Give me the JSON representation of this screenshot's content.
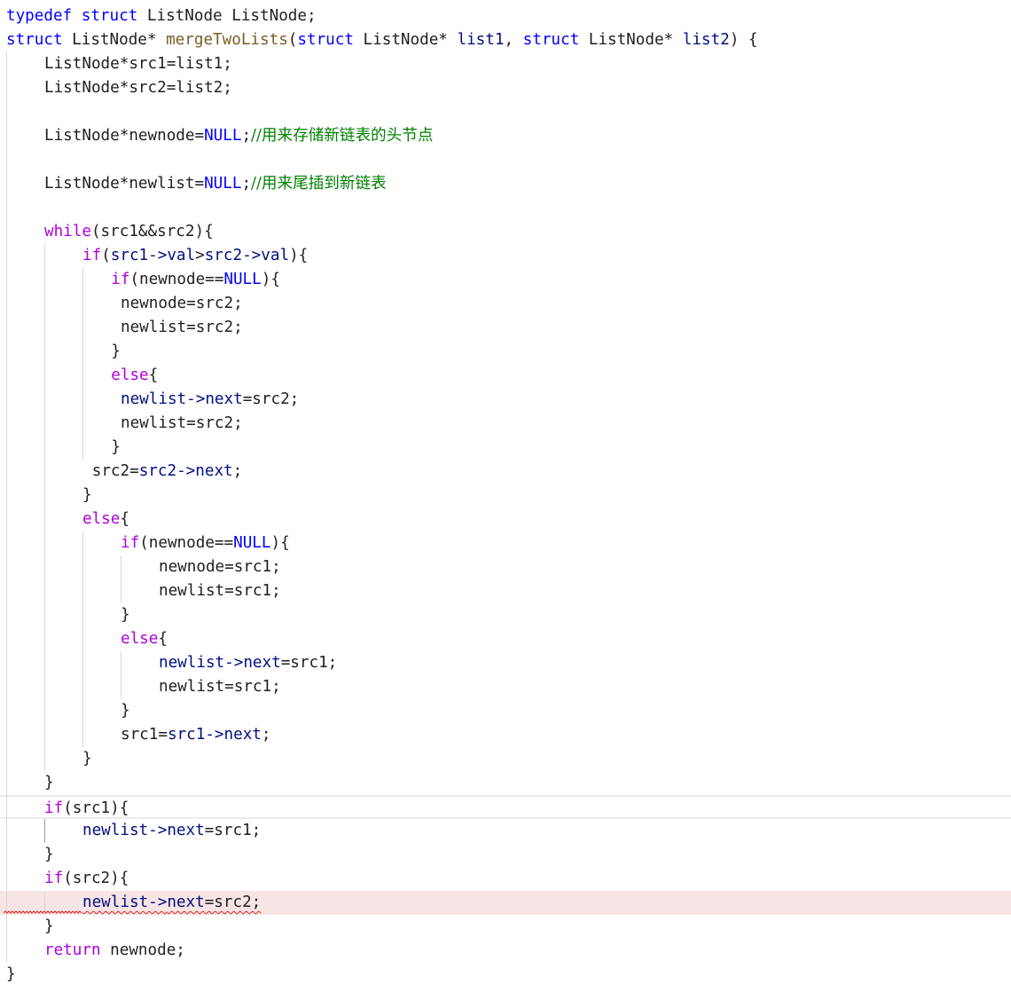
{
  "editor": {
    "language": "c",
    "colors": {
      "keyword": "#0000ff",
      "control": "#af00db",
      "function": "#795e26",
      "macro": "#0000ff",
      "member": "#001080",
      "comment": "#008000",
      "text": "#1f1f1f",
      "error_bg": "#f7e4e4",
      "error_squiggle": "#e02020",
      "indent_guide": "#d8d8d8"
    },
    "lines": [
      {
        "indent": 0,
        "tokens": [
          {
            "t": "typedef",
            "c": "kw"
          },
          {
            "t": " "
          },
          {
            "t": "struct",
            "c": "kw"
          },
          {
            "t": " ListNode ListNode;"
          }
        ]
      },
      {
        "indent": 0,
        "tokens": [
          {
            "t": "struct",
            "c": "kw"
          },
          {
            "t": " ListNode* "
          },
          {
            "t": "mergeTwoLists",
            "c": "fn"
          },
          {
            "t": "("
          },
          {
            "t": "struct",
            "c": "kw"
          },
          {
            "t": " ListNode* "
          },
          {
            "t": "list1",
            "c": "param"
          },
          {
            "t": ", "
          },
          {
            "t": "struct",
            "c": "kw"
          },
          {
            "t": " ListNode* "
          },
          {
            "t": "list2",
            "c": "param"
          },
          {
            "t": ") {"
          }
        ]
      },
      {
        "indent": 1,
        "tokens": [
          {
            "t": "ListNode*src1=list1;"
          }
        ]
      },
      {
        "indent": 1,
        "tokens": [
          {
            "t": "ListNode*src2=list2;"
          }
        ]
      },
      {
        "indent": 1,
        "tokens": []
      },
      {
        "indent": 1,
        "tokens": [
          {
            "t": "ListNode*newnode="
          },
          {
            "t": "NULL",
            "c": "macro"
          },
          {
            "t": ";"
          },
          {
            "t": "//用来存储新链表的头节点",
            "c": "cmt"
          }
        ]
      },
      {
        "indent": 1,
        "tokens": []
      },
      {
        "indent": 1,
        "tokens": [
          {
            "t": "ListNode*newlist="
          },
          {
            "t": "NULL",
            "c": "macro"
          },
          {
            "t": ";"
          },
          {
            "t": "//用来尾插到新链表",
            "c": "cmt"
          }
        ]
      },
      {
        "indent": 1,
        "tokens": []
      },
      {
        "indent": 1,
        "tokens": [
          {
            "t": "while",
            "c": "ctrl"
          },
          {
            "t": "(src1&&src2){"
          }
        ]
      },
      {
        "indent": 2,
        "tokens": [
          {
            "t": "if",
            "c": "ctrl"
          },
          {
            "t": "("
          },
          {
            "t": "src1->",
            "c": "mem"
          },
          {
            "t": "val",
            "c": "mem"
          },
          {
            "t": ">"
          },
          {
            "t": "src2->",
            "c": "mem"
          },
          {
            "t": "val",
            "c": "mem"
          },
          {
            "t": "){"
          }
        ]
      },
      {
        "indent": 2.75,
        "tokens": [
          {
            "t": "if",
            "c": "ctrl"
          },
          {
            "t": "(newnode=="
          },
          {
            "t": "NULL",
            "c": "macro"
          },
          {
            "t": "){"
          }
        ]
      },
      {
        "indent": 3,
        "tokens": [
          {
            "t": "newnode=src2;"
          }
        ]
      },
      {
        "indent": 3,
        "tokens": [
          {
            "t": "newlist=src2;"
          }
        ]
      },
      {
        "indent": 2.75,
        "tokens": [
          {
            "t": "}"
          }
        ]
      },
      {
        "indent": 2.75,
        "tokens": [
          {
            "t": "else",
            "c": "ctrl"
          },
          {
            "t": "{"
          }
        ]
      },
      {
        "indent": 3,
        "tokens": [
          {
            "t": "newlist->",
            "c": "mem"
          },
          {
            "t": "next",
            "c": "mem"
          },
          {
            "t": "=src2;"
          }
        ]
      },
      {
        "indent": 3,
        "tokens": [
          {
            "t": "newlist=src2;"
          }
        ]
      },
      {
        "indent": 2.75,
        "tokens": [
          {
            "t": "}"
          }
        ]
      },
      {
        "indent": 2.25,
        "tokens": [
          {
            "t": "src2="
          },
          {
            "t": "src2->",
            "c": "mem"
          },
          {
            "t": "next",
            "c": "mem"
          },
          {
            "t": ";"
          }
        ]
      },
      {
        "indent": 2,
        "tokens": [
          {
            "t": "}"
          }
        ]
      },
      {
        "indent": 2,
        "tokens": [
          {
            "t": "else",
            "c": "ctrl"
          },
          {
            "t": "{"
          }
        ]
      },
      {
        "indent": 3,
        "tokens": [
          {
            "t": "if",
            "c": "ctrl"
          },
          {
            "t": "(newnode=="
          },
          {
            "t": "NULL",
            "c": "macro"
          },
          {
            "t": "){"
          }
        ]
      },
      {
        "indent": 4,
        "tokens": [
          {
            "t": "newnode=src1;"
          }
        ]
      },
      {
        "indent": 4,
        "tokens": [
          {
            "t": "newlist=src1;"
          }
        ]
      },
      {
        "indent": 3,
        "tokens": [
          {
            "t": "}"
          }
        ]
      },
      {
        "indent": 3,
        "tokens": [
          {
            "t": "else",
            "c": "ctrl"
          },
          {
            "t": "{"
          }
        ]
      },
      {
        "indent": 4,
        "tokens": [
          {
            "t": "newlist->",
            "c": "mem"
          },
          {
            "t": "next",
            "c": "mem"
          },
          {
            "t": "=src1;"
          }
        ]
      },
      {
        "indent": 4,
        "tokens": [
          {
            "t": "newlist=src1;"
          }
        ]
      },
      {
        "indent": 3,
        "tokens": [
          {
            "t": "}"
          }
        ]
      },
      {
        "indent": 3,
        "tokens": [
          {
            "t": "src1="
          },
          {
            "t": "src1->",
            "c": "mem"
          },
          {
            "t": "next",
            "c": "mem"
          },
          {
            "t": ";"
          }
        ]
      },
      {
        "indent": 2,
        "tokens": [
          {
            "t": "}"
          }
        ]
      },
      {
        "indent": 1,
        "tokens": [
          {
            "t": "}"
          }
        ]
      },
      {
        "indent": 1,
        "current": true,
        "tokens": [
          {
            "t": "if",
            "c": "ctrl"
          },
          {
            "t": "(src1){"
          }
        ]
      },
      {
        "indent": 2,
        "tokens": [
          {
            "t": "newlist->",
            "c": "mem"
          },
          {
            "t": "next",
            "c": "mem"
          },
          {
            "t": "=src1;"
          }
        ]
      },
      {
        "indent": 1,
        "tokens": [
          {
            "t": "}"
          }
        ]
      },
      {
        "indent": 1,
        "tokens": [
          {
            "t": "if",
            "c": "ctrl"
          },
          {
            "t": "(src2){"
          }
        ]
      },
      {
        "indent": 2,
        "error": true,
        "tokens": [
          {
            "t": "newlist->",
            "c": "mem"
          },
          {
            "t": "next",
            "c": "mem"
          },
          {
            "t": "=src2;"
          }
        ]
      },
      {
        "indent": 1,
        "tokens": [
          {
            "t": "}"
          }
        ]
      },
      {
        "indent": 1,
        "tokens": [
          {
            "t": "return",
            "c": "ctrl"
          },
          {
            "t": " newnode;"
          }
        ]
      },
      {
        "indent": 0,
        "tokens": [
          {
            "t": "}"
          }
        ]
      }
    ]
  }
}
